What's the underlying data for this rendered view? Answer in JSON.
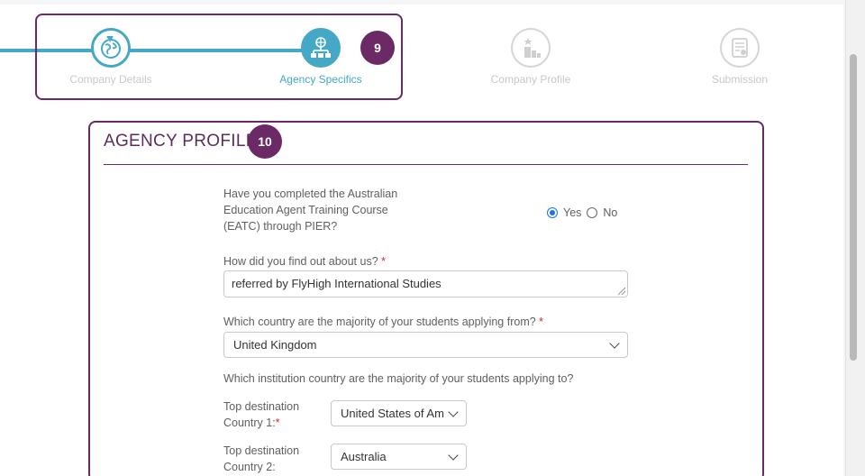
{
  "stepper": {
    "steps": [
      {
        "label": "Company Details",
        "state": "done",
        "icon": "globe-pin-icon"
      },
      {
        "label": "Agency Specifics",
        "state": "active",
        "icon": "network-globe-icon"
      },
      {
        "label": "Company Profile",
        "state": "todo",
        "icon": "podium-icon"
      },
      {
        "label": "Submission",
        "state": "todo",
        "icon": "certificate-icon"
      }
    ],
    "badge": "9"
  },
  "section": {
    "title": "AGENCY PROFILE",
    "badge": "10"
  },
  "form": {
    "eatc_question": "Have you completed the Australian Education Agent Training Course (EATC) through PIER?",
    "eatc_yes": "Yes",
    "eatc_no": "No",
    "eatc_selected": "Yes",
    "referral_label": "How did you find out about us?",
    "referral_value": "referred by FlyHigh International Studies",
    "origin_label": "Which country are the majority of your students applying from?",
    "origin_value": "United Kingdom",
    "destination_label": "Which institution country are the majority of your students applying to?",
    "dest1_label": "Top destination Country 1:",
    "dest1_value": "United States of Am",
    "dest2_label": "Top destination Country 2:",
    "dest2_value": "Australia",
    "required_mark": "*"
  },
  "colors": {
    "accent": "#45a8c4",
    "annotation": "#6b2a66",
    "required": "#d6262f"
  }
}
